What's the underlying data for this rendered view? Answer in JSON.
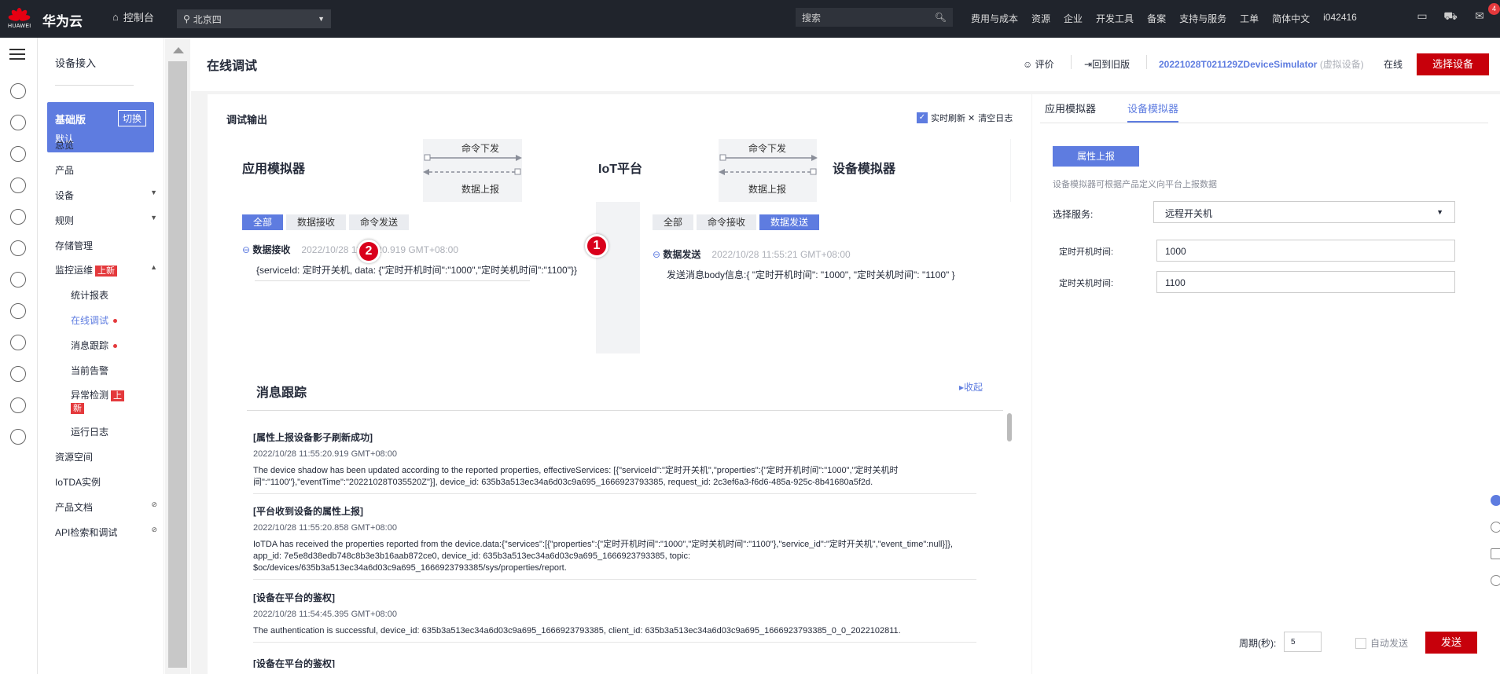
{
  "topbar": {
    "logo_text": "HUAWEI",
    "brand": "华为云",
    "console": "控制台",
    "region": "北京四",
    "search_placeholder": "搜索",
    "nav": [
      "费用与成本",
      "资源",
      "企业",
      "开发工具",
      "备案",
      "支持与服务",
      "工单",
      "简体中文",
      "i042416"
    ],
    "badge": "4"
  },
  "sidebar": {
    "title": "设备接入",
    "plan_title": "基础版",
    "plan_sub": "默认",
    "switch": "切换",
    "items": [
      "总览",
      "产品",
      "设备",
      "规则",
      "存储管理",
      "监控运维",
      "统计报表",
      "在线调试",
      "消息跟踪",
      "当前告警",
      "异常检测",
      "运行日志",
      "资源空间",
      "IoTDA实例",
      "产品文档",
      "API检索和调试"
    ],
    "new_tag": "上新",
    "new_tag_split_a": "上",
    "new_tag_split_b": "新"
  },
  "header": {
    "title": "在线调试",
    "rate": "评价",
    "old": "回到旧版",
    "device": "20221028T021129ZDeviceSimulator",
    "device_virtual": "(虚拟设备)",
    "status": "在线",
    "select_device": "选择设备"
  },
  "debug": {
    "title": "调试输出",
    "realtime": "实时刷新",
    "clear": "清空日志",
    "app_sim": "应用模拟器",
    "iot": "IoT平台",
    "dev_sim": "设备模拟器",
    "cmd_down": "命令下发",
    "data_up": "数据上报",
    "left_tabs": [
      "全部",
      "数据接收",
      "命令发送"
    ],
    "right_tabs": [
      "全部",
      "命令接收",
      "数据发送"
    ],
    "left_log": {
      "key": "数据接收",
      "time": "2022/10/28 11:55:20.919 GMT+08:00",
      "text": "{serviceId: 定时开关机, data: {\"定时开机时间\":\"1000\",\"定时关机时间\":\"1100\"}}"
    },
    "right_log": {
      "key": "数据发送",
      "time": "2022/10/28 11:55:21 GMT+08:00",
      "text": "发送消息body信息:{ \"定时开机时间\": \"1000\", \"定时关机时间\": \"1100\" }"
    },
    "marker1": "1",
    "marker2": "2"
  },
  "trace": {
    "title": "消息跟踪",
    "collapse": "收起",
    "entries": [
      {
        "head": "[属性上报设备影子刷新成功]",
        "time": "2022/10/28 11:55:20.919 GMT+08:00",
        "body": "The device shadow has been updated according to the reported properties, effectiveServices: [{\"serviceId\":\"定时开关机\",\"properties\":{\"定时开机时间\":\"1000\",\"定时关机时间\":\"1100\"},\"eventTime\":\"20221028T035520Z\"}], device_id: 635b3a513ec34a6d03c9a695_1666923793385, request_id: 2c3ef6a3-f6d6-485a-925c-8b41680a5f2d."
      },
      {
        "head": "[平台收到设备的属性上报]",
        "time": "2022/10/28 11:55:20.858 GMT+08:00",
        "body": "IoTDA has received the properties reported from the device.data:{\"services\":[{\"properties\":{\"定时开机时间\":\"1000\",\"定时关机时间\":\"1100\"},\"service_id\":\"定时开关机\",\"event_time\":null}]}, app_id: 7e5e8d38edb748c8b3e3b16aab872ce0, device_id: 635b3a513ec34a6d03c9a695_1666923793385, topic: $oc/devices/635b3a513ec34a6d03c9a695_1666923793385/sys/properties/report."
      },
      {
        "head": "[设备在平台的鉴权]",
        "time": "2022/10/28 11:54:45.395 GMT+08:00",
        "body": "The authentication is successful, device_id: 635b3a513ec34a6d03c9a695_1666923793385, client_id: 635b3a513ec34a6d03c9a695_1666923793385_0_0_2022102811."
      },
      {
        "head": "[设备在平台的鉴权]",
        "time": "",
        "body": ""
      }
    ]
  },
  "right": {
    "tabs": [
      "应用模拟器",
      "设备模拟器"
    ],
    "report_btn": "属性上报",
    "hint": "设备模拟器可根据产品定义向平台上报数据",
    "service_label": "选择服务:",
    "service_value": "远程开关机",
    "on_label": "定时开机时间:",
    "on_value": "1000",
    "off_label": "定时关机时间:",
    "off_value": "1100",
    "period_label": "周期(秒):",
    "period_value": "5",
    "auto_send": "自动发送",
    "send": "发送"
  },
  "colors": {
    "accent": "#5e7ce0",
    "danger": "#c7000b",
    "topbar": "#20242c"
  }
}
